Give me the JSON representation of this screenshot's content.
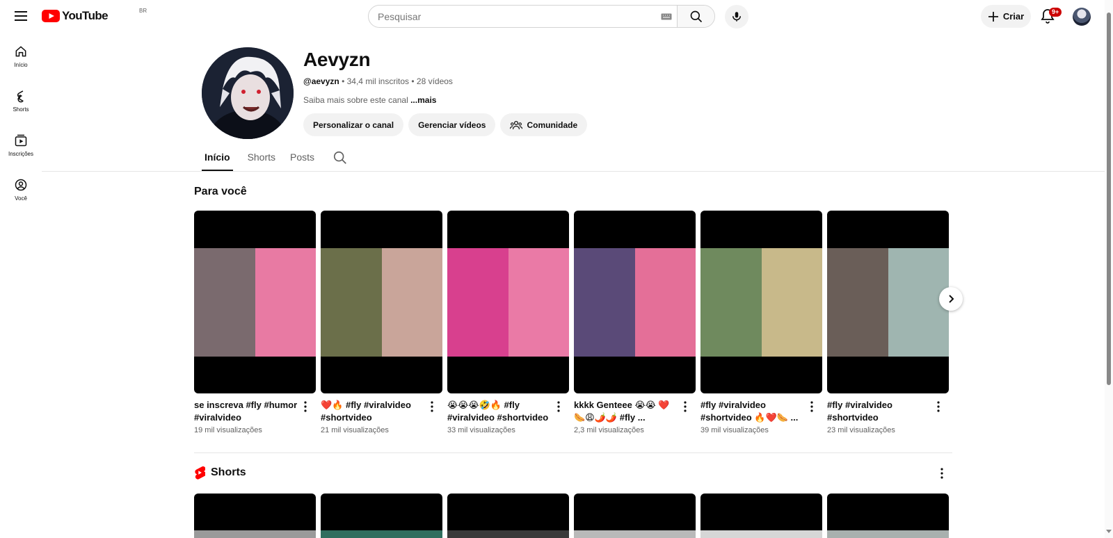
{
  "topbar": {
    "logo_text": "YouTube",
    "region": "BR",
    "search_placeholder": "Pesquisar",
    "create_label": "Criar",
    "notifications_badge": "9+"
  },
  "sidebar": {
    "items": [
      {
        "label": "Início",
        "icon": "home-icon"
      },
      {
        "label": "Shorts",
        "icon": "shorts-icon"
      },
      {
        "label": "Inscrições",
        "icon": "subscriptions-icon"
      },
      {
        "label": "Você",
        "icon": "you-icon"
      }
    ]
  },
  "channel": {
    "name": "Aevyzn",
    "handle": "@aevyzn",
    "subscribers": "34,4 mil inscritos",
    "videos": "28 vídeos",
    "separator": "•",
    "description": "Saiba mais sobre este canal",
    "more": "...mais",
    "buttons": {
      "customize": "Personalizar o canal",
      "manage": "Gerenciar vídeos",
      "community": "Comunidade"
    }
  },
  "tabs": [
    {
      "label": "Início",
      "active": true
    },
    {
      "label": "Shorts",
      "active": false
    },
    {
      "label": "Posts",
      "active": false
    }
  ],
  "for_you": {
    "title": "Para você",
    "videos": [
      {
        "title": "se inscreva #fly #humor #viralvideo",
        "views": "19 mil visualizações",
        "left": "#7a6a6e",
        "right": "#e87aa3"
      },
      {
        "title": "❤️🔥 #fly #viralvideo #shortvideo",
        "views": "21 mil visualizações",
        "left": "#6b6f4a",
        "right": "#c9a59a"
      },
      {
        "title": "😭😭😭🤣🔥 #fly #viralvideo #shortvideo",
        "views": "33 mil visualizações",
        "left": "#d8408e",
        "right": "#ea7aa6"
      },
      {
        "title": "kkkk Genteee 😭😭 ❤️🌭😩🌶️🌶️ #fly ...",
        "views": "2,3 mil visualizações",
        "left": "#5a4a78",
        "right": "#e46f98"
      },
      {
        "title": "#fly #viralvideo #shortvideo 🔥❤️🌭 ...",
        "views": "39 mil visualizações",
        "left": "#6f8a5e",
        "right": "#c8b98a"
      },
      {
        "title": "#fly #viralvideo #shortvideo",
        "views": "23 mil visualizações",
        "left": "#6a5e58",
        "right": "#9fb5b0"
      }
    ]
  },
  "shorts_section": {
    "title": "Shorts",
    "strips": [
      "#9a9a9a",
      "#2f6e5e",
      "#3a3a3a",
      "#b9b9b9",
      "#d6d6d6",
      "#a8b0ae"
    ]
  },
  "colors": {
    "brand_red": "#ff0000",
    "text_primary": "#0f0f0f",
    "text_secondary": "#606060",
    "chip_bg": "#f2f2f2"
  }
}
